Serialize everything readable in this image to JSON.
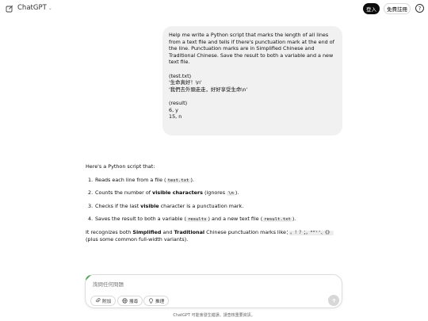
{
  "header": {
    "brand": "ChatGPT",
    "login": "登入",
    "signup": "免費註冊",
    "help": "?"
  },
  "user_message": {
    "lines": [
      "Help me write a Python script that marks the length of all lines from a text file and tells if there's punctuation mark at the end of the line. Punctuation marks are in Simplified Chinese and Traditional Chinese. Save the result to both a variable and a new text file.",
      "",
      "(test.txt)\n'生命真好！\\n'\n'我們去外頭走走，好好享受生命\\n'",
      "",
      "(result)\n6, y\n15, n"
    ]
  },
  "assistant": {
    "intro": "Here's a Python script that:",
    "steps": [
      {
        "num": "1.",
        "pre": "Reads each line from a file (",
        "code": "test.txt",
        "post": ")."
      },
      {
        "num": "2.",
        "pre": "Counts the number of ",
        "bold": "visible characters",
        "mid": " (ignores ",
        "code": "\\n",
        "post": ")."
      },
      {
        "num": "3.",
        "pre": "Checks if the last ",
        "bold": "visible",
        "post": " character is a punctuation mark."
      },
      {
        "num": "4.",
        "pre": "Saves the result to both a variable (",
        "code": "results",
        "mid": ") and a new text file (",
        "code2": "result.txt",
        "post": ")."
      }
    ],
    "closing": {
      "pre": "It recognizes both ",
      "bold1": "Simplified",
      "and": " and ",
      "bold2": "Traditional",
      "mid": " Chinese punctuation marks like：",
      "code": "。！？；，“”‘’、《》",
      "post": "(plus some common full-width variants)."
    }
  },
  "composer": {
    "placeholder": "詢問任何問題",
    "attach": "附加",
    "search": "搜尋",
    "reason": "推理"
  },
  "footer": "ChatGPT 可能會發生錯誤。請查核重要資訊。"
}
